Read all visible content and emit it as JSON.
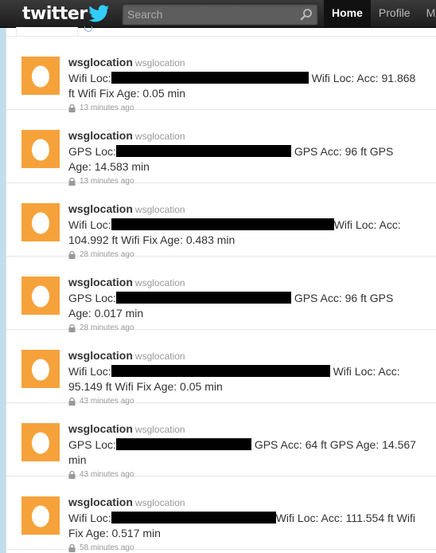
{
  "header": {
    "logo": "twitter",
    "search": {
      "placeholder": "Search",
      "value": ""
    },
    "nav": [
      "Home",
      "Profile",
      "Me"
    ]
  },
  "tweets": [
    {
      "screen_name": "wsglocation",
      "handle": "wsglocation",
      "prefix": "Wifi Loc:",
      "rest": "Wifi Loc: Acc: 91.868 ft Wifi Fix Age: 0.05 min",
      "time": "13 minutes ago"
    },
    {
      "screen_name": "wsglocation",
      "handle": "wsglocation",
      "prefix": "GPS Loc:",
      "rest": "GPS Acc: 96 ft GPS Age: 14.583 min",
      "time": "13 minutes ago"
    },
    {
      "screen_name": "wsglocation",
      "handle": "wsglocation",
      "prefix": "Wifi Loc:",
      "rest": "Wifi Loc: Acc: 104.992 ft Wifi Fix Age: 0.483 min",
      "time": "28 minutes ago"
    },
    {
      "screen_name": "wsglocation",
      "handle": "wsglocation",
      "prefix": "GPS Loc:",
      "rest": "GPS Acc: 96 ft GPS Age: 0.017 min",
      "time": "28 minutes ago"
    },
    {
      "screen_name": "wsglocation",
      "handle": "wsglocation",
      "prefix": "Wifi Loc:",
      "rest": "Wifi Loc: Acc: 95.149 ft Wifi Fix Age: 0.05 min",
      "time": "43 minutes ago"
    },
    {
      "screen_name": "wsglocation",
      "handle": "wsglocation",
      "prefix": "GPS Loc:",
      "rest": "GPS Acc: 64 ft GPS Age: 14.567 min",
      "time": "43 minutes ago"
    },
    {
      "screen_name": "wsglocation",
      "handle": "wsglocation",
      "prefix": "Wifi Loc:",
      "rest": "Wifi Loc: Acc: 111.554 ft Wifi Fix Age: 0.517 min",
      "time": "58 minutes ago"
    }
  ],
  "colors": {
    "topbar": "#262626",
    "avatar": "#f6a23b",
    "background": "#c0deed"
  }
}
